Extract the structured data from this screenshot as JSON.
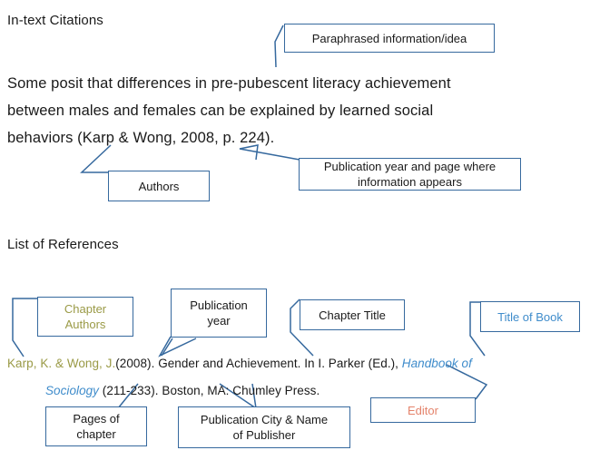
{
  "document": {
    "title": "APA In-text Citations and List of References annotated example"
  },
  "sections": {
    "intext": {
      "heading": "In-text Citations",
      "paragraph_line1": "Some posit that differences in pre-pubescent literacy achievement",
      "paragraph_line2": "between males and females can be explained by learned social",
      "paragraph_line3": "behaviors (Karp & Wong, 2008, p. 224)."
    },
    "references": {
      "heading": "List of References",
      "citation_authors": "Karp, K. & Wong, J.",
      "citation_year_title": "(2008).  Gender and Achievement. In I. Parker (Ed.), ",
      "citation_booktitle_line1": "Handbook of",
      "citation_booktitle_line2": "Sociology",
      "citation_rest": " (211-233). Boston, MA: Chumley Press."
    }
  },
  "callouts": {
    "paraphrased": {
      "label": "Paraphrased information/idea"
    },
    "authors": {
      "label": "Authors"
    },
    "pubyear_page": {
      "line1": "Publication year and page where",
      "line2": "information appears"
    },
    "chapter_authors": {
      "line1": "Chapter",
      "line2": "Authors",
      "color": "#9a9a46"
    },
    "publication_year": {
      "line1": "Publication",
      "line2": "year"
    },
    "chapter_title": {
      "label": "Chapter Title"
    },
    "title_of_book": {
      "label": "Title of Book",
      "color": "#3f8ccb"
    },
    "editor": {
      "label": "Editor",
      "color": "#e4836b"
    },
    "pages_of_chapter": {
      "line1": "Pages of",
      "line2": "chapter"
    },
    "publication_city": {
      "line1": "Publication City & Name",
      "line2": "of Publisher"
    }
  },
  "colors": {
    "box_border": "#36699e",
    "leader_line": "#36699e",
    "olive_text": "#9a9a46",
    "blue_text": "#3f8ccb",
    "salmon_text": "#e4836b",
    "body_text": "#1a1a1a",
    "background": "#ffffff"
  }
}
